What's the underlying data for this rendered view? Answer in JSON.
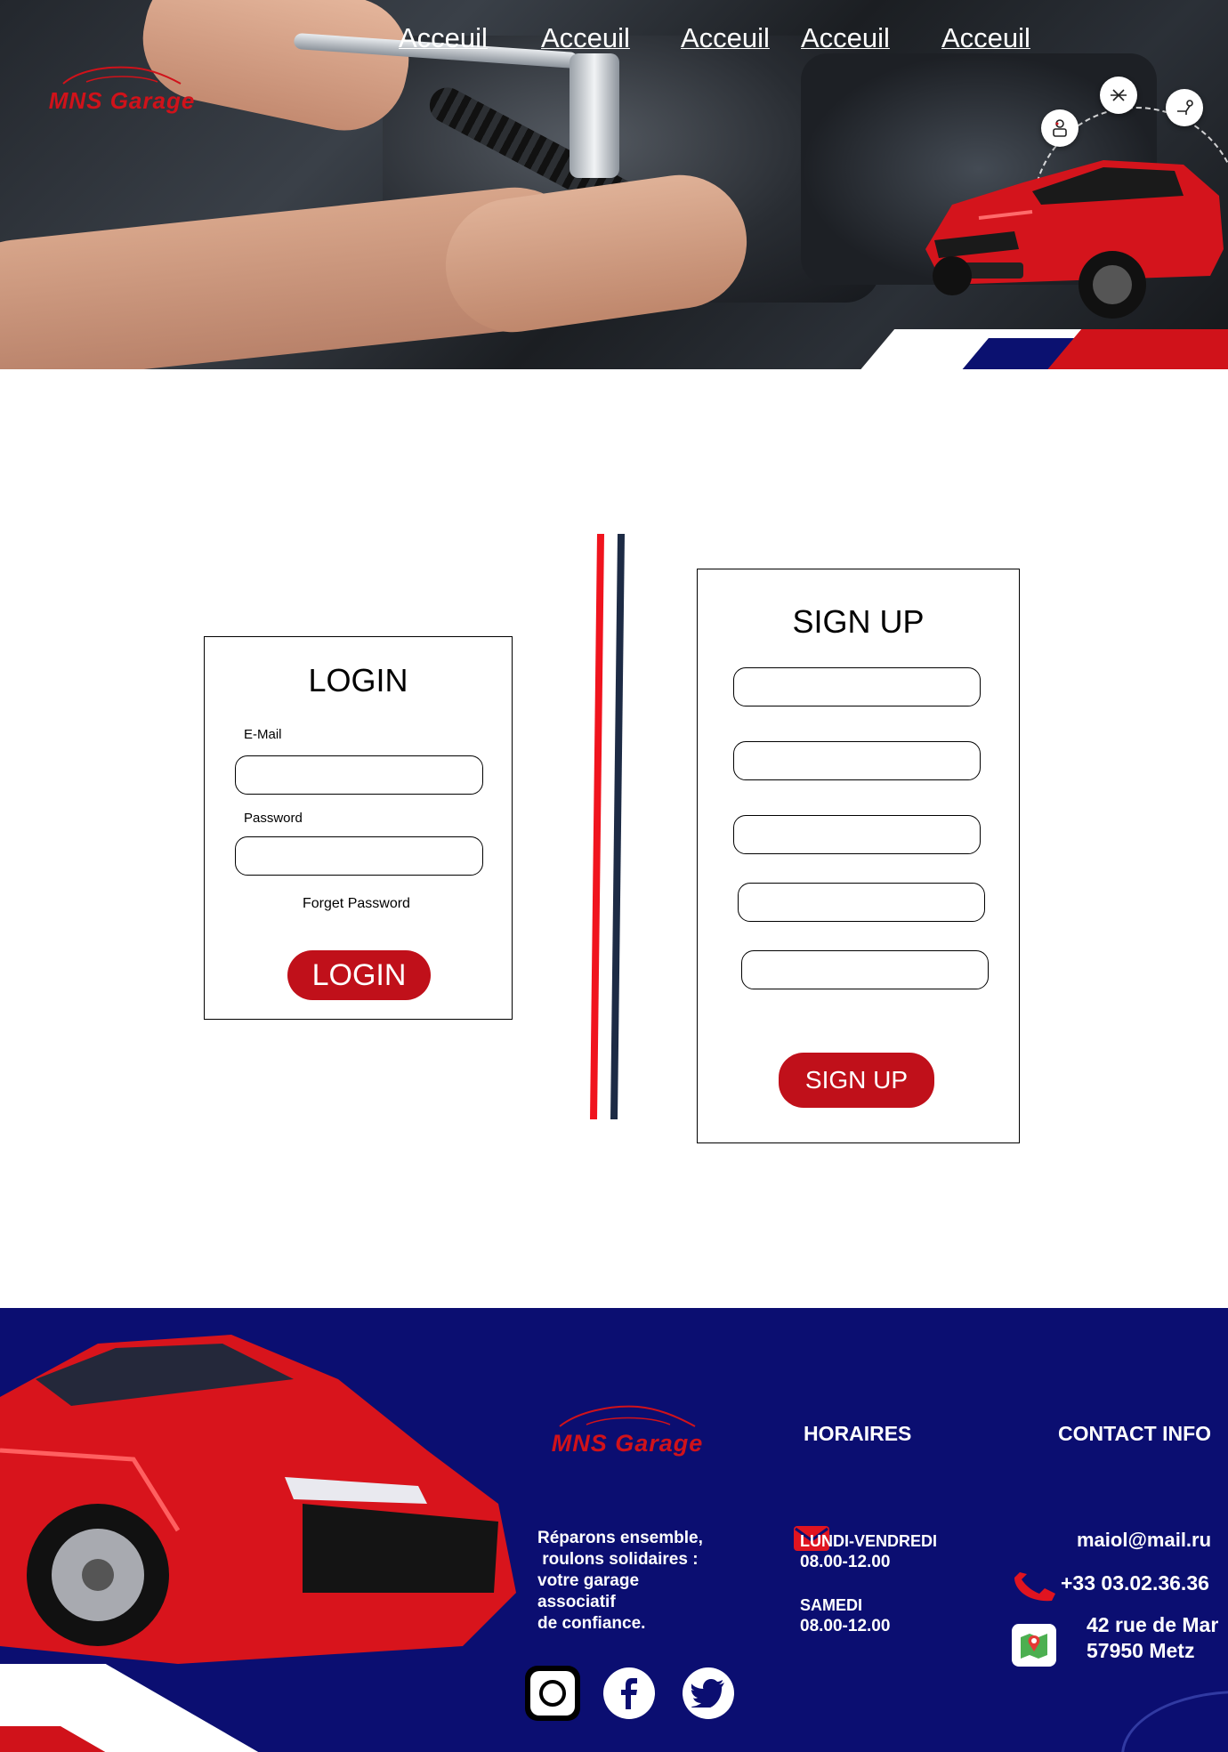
{
  "brand": {
    "name": "MNS Garage",
    "color": "#d0121a"
  },
  "nav": {
    "items": [
      "Acceuil",
      "Acceuil",
      "Acceuil",
      "Acceuil",
      "Acceuil"
    ]
  },
  "hero": {
    "services": [
      "mechanic-icon",
      "lift-icon",
      "repair-icon"
    ]
  },
  "login": {
    "title": "LOGIN",
    "email_label": "E-Mail",
    "email_value": "",
    "password_label": "Password",
    "password_value": "",
    "forgot": "Forget Password",
    "button": "LOGIN"
  },
  "signup": {
    "title": "SIGN UP",
    "fields": [
      "",
      "",
      "",
      "",
      ""
    ],
    "button": "SIGN UP"
  },
  "divider_colors": [
    "#f0141e",
    "#1d2b45"
  ],
  "footer": {
    "bg": "#0b0e71",
    "tagline": "Réparons ensemble,\n roulons solidaires :\nvotre garage\nassociatif\nde confiance.",
    "hours_title": "HORAIRES",
    "hours": [
      {
        "day": "LUNDI-VENDREDI",
        "time": "08.00-12.00"
      },
      {
        "day": "SAMEDI",
        "time": "08.00-12.00"
      }
    ],
    "contact_title": "CONTACT INFO",
    "email": "maiol@mail.ru",
    "phone": "+33 03.02.36.36",
    "address": [
      "42 rue de Mar",
      "57950 Metz"
    ],
    "social": [
      "instagram-icon",
      "facebook-icon",
      "twitter-icon"
    ]
  }
}
